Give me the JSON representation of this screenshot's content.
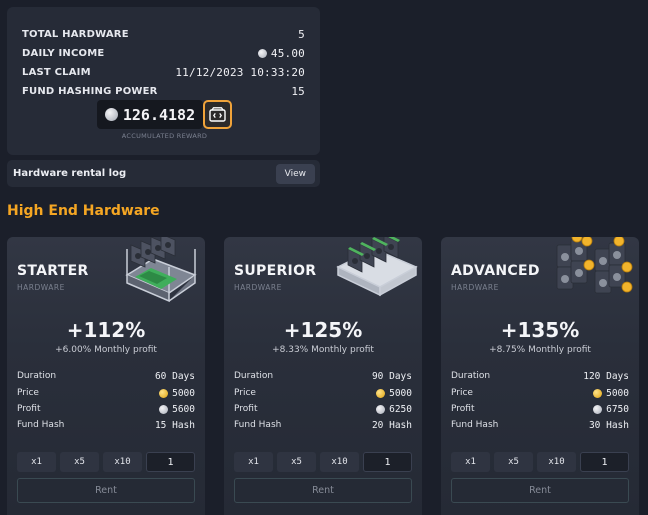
{
  "stats": {
    "rows": [
      {
        "label": "TOTAL HARDWARE",
        "value": "5",
        "coin": ""
      },
      {
        "label": "DAILY INCOME",
        "value": "45.00",
        "coin": "silver"
      },
      {
        "label": "LAST CLAIM",
        "value": "11/12/2023 10:33:20",
        "coin": ""
      },
      {
        "label": "FUND HASHING POWER",
        "value": "15",
        "coin": ""
      }
    ],
    "reward_value": "126.4182",
    "reward_caption": "ACCUMULATED REWARD",
    "claim_icon": "claim-reward-icon"
  },
  "rental_log": {
    "label": "Hardware rental log",
    "button": "View"
  },
  "section_title": "High End Hardware",
  "cards": [
    {
      "name": "STARTER",
      "sub": "HARDWARE",
      "pct": "+112%",
      "monthly": "+6.00% Monthly profit",
      "duration_label": "Duration",
      "duration": "60 Days",
      "price_label": "Price",
      "price": "5000",
      "profit_label": "Profit",
      "profit": "5600",
      "hash_label": "Fund Hash",
      "hash": "15 Hash",
      "qty": [
        "x1",
        "x5",
        "x10"
      ],
      "quantity": "1",
      "rent": "Rent"
    },
    {
      "name": "SUPERIOR",
      "sub": "HARDWARE",
      "pct": "+125%",
      "monthly": "+8.33% Monthly profit",
      "duration_label": "Duration",
      "duration": "90 Days",
      "price_label": "Price",
      "price": "5000",
      "profit_label": "Profit",
      "profit": "6250",
      "hash_label": "Fund Hash",
      "hash": "20 Hash",
      "qty": [
        "x1",
        "x5",
        "x10"
      ],
      "quantity": "1",
      "rent": "Rent"
    },
    {
      "name": "ADVANCED",
      "sub": "HARDWARE",
      "pct": "+135%",
      "monthly": "+8.75% Monthly profit",
      "duration_label": "Duration",
      "duration": "120 Days",
      "price_label": "Price",
      "price": "5000",
      "profit_label": "Profit",
      "profit": "6750",
      "hash_label": "Fund Hash",
      "hash": "30 Hash",
      "qty": [
        "x1",
        "x5",
        "x10"
      ],
      "quantity": "1",
      "rent": "Rent"
    }
  ],
  "colors": {
    "accent": "#f5a623",
    "background": "#1b1f2a",
    "panel": "#262b37"
  }
}
